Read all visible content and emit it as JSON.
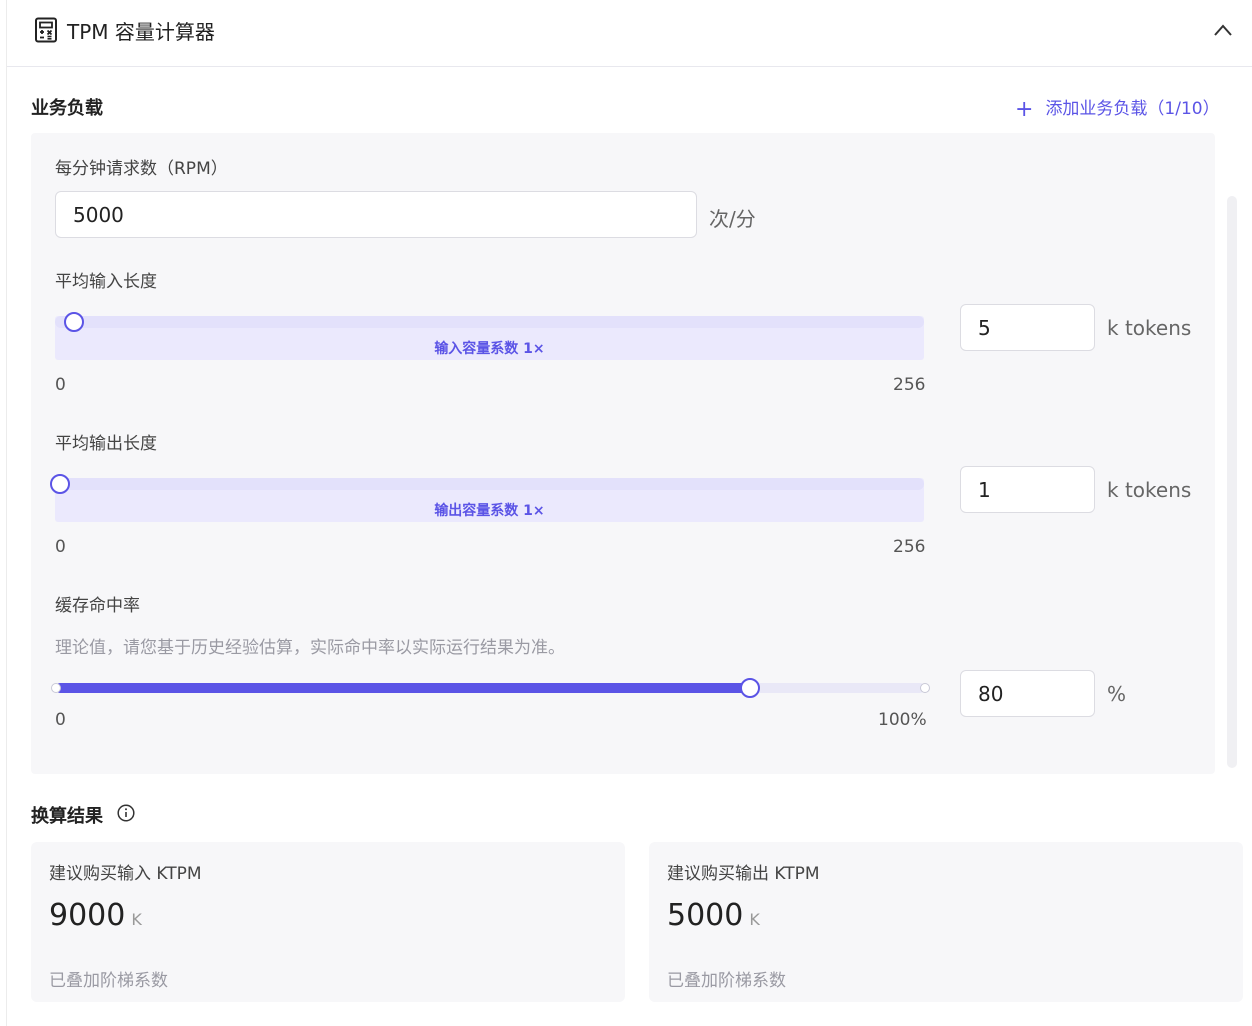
{
  "header": {
    "title": "TPM 容量计算器",
    "calc_icon": "calculator-icon",
    "collapse_icon": "chevron-up-icon"
  },
  "workload": {
    "section_title": "业务负载",
    "add_label": "添加业务负载（1/10）",
    "rpm": {
      "label": "每分钟请求数（RPM）",
      "value": "5000",
      "unit": "次/分"
    },
    "input_length": {
      "label": "平均输入长度",
      "coef_label": "输入容量系数 1×",
      "min": "0",
      "max": "256",
      "value": "5",
      "level": 5,
      "unit": "k tokens"
    },
    "output_length": {
      "label": "平均输出长度",
      "coef_label": "输出容量系数 1×",
      "min": "0",
      "max": "256",
      "value": "1",
      "level": 1,
      "unit": "k tokens"
    },
    "cache": {
      "label": "缓存命中率",
      "hint": "理论值，请您基于历史经验估算，实际命中率以实际运行结果为准。",
      "min": "0",
      "max": "100%",
      "value": "80",
      "level_percent": 80,
      "unit": "%"
    }
  },
  "results": {
    "section_title": "换算结果",
    "info_icon": "info-icon",
    "cards": [
      {
        "title": "建议购买输入 KTPM",
        "value": "9000",
        "unit": "K",
        "footer": "已叠加阶梯系数"
      },
      {
        "title": "建议购买输出 KTPM",
        "value": "5000",
        "unit": "K",
        "footer": "已叠加阶梯系数"
      }
    ]
  },
  "colors": {
    "accent": "#5b54e6",
    "band": "#ebe9fd",
    "panel_bg": "#f7f7f9"
  }
}
